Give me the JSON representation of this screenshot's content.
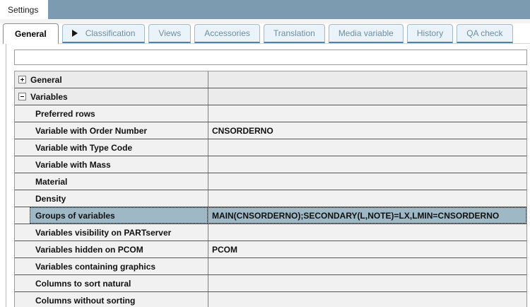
{
  "window": {
    "title": "Settings"
  },
  "tab_bar": {
    "tabs": [
      {
        "label": "General",
        "active": true,
        "has_arrow": false
      },
      {
        "label": "Classification",
        "active": false,
        "has_arrow": true
      },
      {
        "label": "Views",
        "active": false,
        "has_arrow": false
      },
      {
        "label": "Accessories",
        "active": false,
        "has_arrow": false
      },
      {
        "label": "Translation",
        "active": false,
        "has_arrow": false
      },
      {
        "label": "Media variable",
        "active": false,
        "has_arrow": false
      },
      {
        "label": "History",
        "active": false,
        "has_arrow": false
      },
      {
        "label": "QA check",
        "active": false,
        "has_arrow": false
      }
    ]
  },
  "filter_input": {
    "value": "",
    "placeholder": ""
  },
  "property_grid": {
    "rows": [
      {
        "kind": "category",
        "label": "General",
        "expanded": false,
        "value": "",
        "selected": false
      },
      {
        "kind": "category",
        "label": "Variables",
        "expanded": true,
        "value": "",
        "selected": false
      },
      {
        "kind": "property",
        "label": "Preferred rows",
        "value": "",
        "selected": false
      },
      {
        "kind": "property",
        "label": "Variable with Order Number",
        "value": "CNSORDERNO",
        "selected": false
      },
      {
        "kind": "property",
        "label": "Variable with Type Code",
        "value": "",
        "selected": false
      },
      {
        "kind": "property",
        "label": "Variable with Mass",
        "value": "",
        "selected": false
      },
      {
        "kind": "property",
        "label": "Material",
        "value": "",
        "selected": false
      },
      {
        "kind": "property",
        "label": "Density",
        "value": "",
        "selected": false
      },
      {
        "kind": "property",
        "label": "Groups of variables",
        "value": "MAIN(CNSORDERNO);SECONDARY(L,NOTE)=LX,LMIN=CNSORDERNO",
        "selected": true
      },
      {
        "kind": "property",
        "label": "Variables visibility on PARTserver",
        "value": "",
        "selected": false
      },
      {
        "kind": "property",
        "label": "Variables hidden on PCOM",
        "value": "PCOM",
        "selected": false
      },
      {
        "kind": "property",
        "label": "Variables containing graphics",
        "value": "",
        "selected": false
      },
      {
        "kind": "property",
        "label": "Columns to sort natural",
        "value": "",
        "selected": false
      },
      {
        "kind": "property",
        "label": "Columns without sorting",
        "value": "",
        "selected": false
      }
    ]
  },
  "colors": {
    "titlebar_blue": "#7d9bb0",
    "selection_blue": "#9fb8c6",
    "inactive_tab_fill": "#eaf3f9",
    "inactive_tab_border": "#a3bac8",
    "inactive_tab_underline": "#4d83ab",
    "inactive_tab_text": "#6e8e9f",
    "row_bg": "#f1f1f1",
    "category_bg": "#ebebeb",
    "row_separator": "#575757"
  }
}
